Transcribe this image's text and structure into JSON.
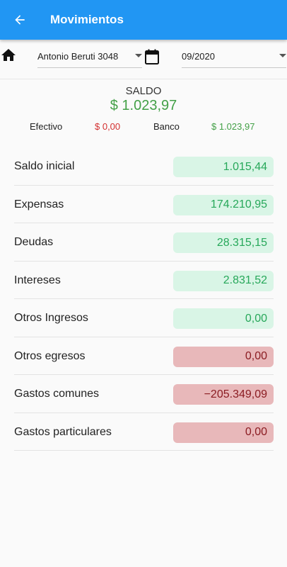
{
  "appbar": {
    "title": "Movimientos",
    "back_icon": "arrow-back-icon"
  },
  "filters": {
    "home_icon": "home-icon",
    "address": "Antonio Beruti 3048",
    "calendar_icon": "calendar-icon",
    "period": "09/2020"
  },
  "summary": {
    "saldo_label": "SALDO",
    "saldo_value": "$ 1.023,97",
    "efectivo_label": "Efectivo",
    "efectivo_value": "$ 0,00",
    "banco_label": "Banco",
    "banco_value": "$ 1.023,97"
  },
  "rows": [
    {
      "label": "Saldo inicial",
      "value": "1.015,44",
      "kind": "pos"
    },
    {
      "label": "Expensas",
      "value": "174.210,95",
      "kind": "pos"
    },
    {
      "label": "Deudas",
      "value": "28.315,15",
      "kind": "pos"
    },
    {
      "label": "Intereses",
      "value": "2.831,52",
      "kind": "pos"
    },
    {
      "label": "Otros Ingresos",
      "value": "0,00",
      "kind": "pos"
    },
    {
      "label": "Otros egresos",
      "value": "0,00",
      "kind": "neg"
    },
    {
      "label": "Gastos comunes",
      "value": "−205.349,09",
      "kind": "neg"
    },
    {
      "label": "Gastos particulares",
      "value": "0,00",
      "kind": "neg"
    }
  ],
  "colors": {
    "appbar": "#2196f3",
    "positive_chip_bg": "#d9f5e6",
    "positive_text": "#27a85a",
    "negative_chip_bg": "#e8b8ba",
    "negative_text": "#8b1c22",
    "saldo_green": "#43a047",
    "efectivo_red": "#d32f2f"
  }
}
